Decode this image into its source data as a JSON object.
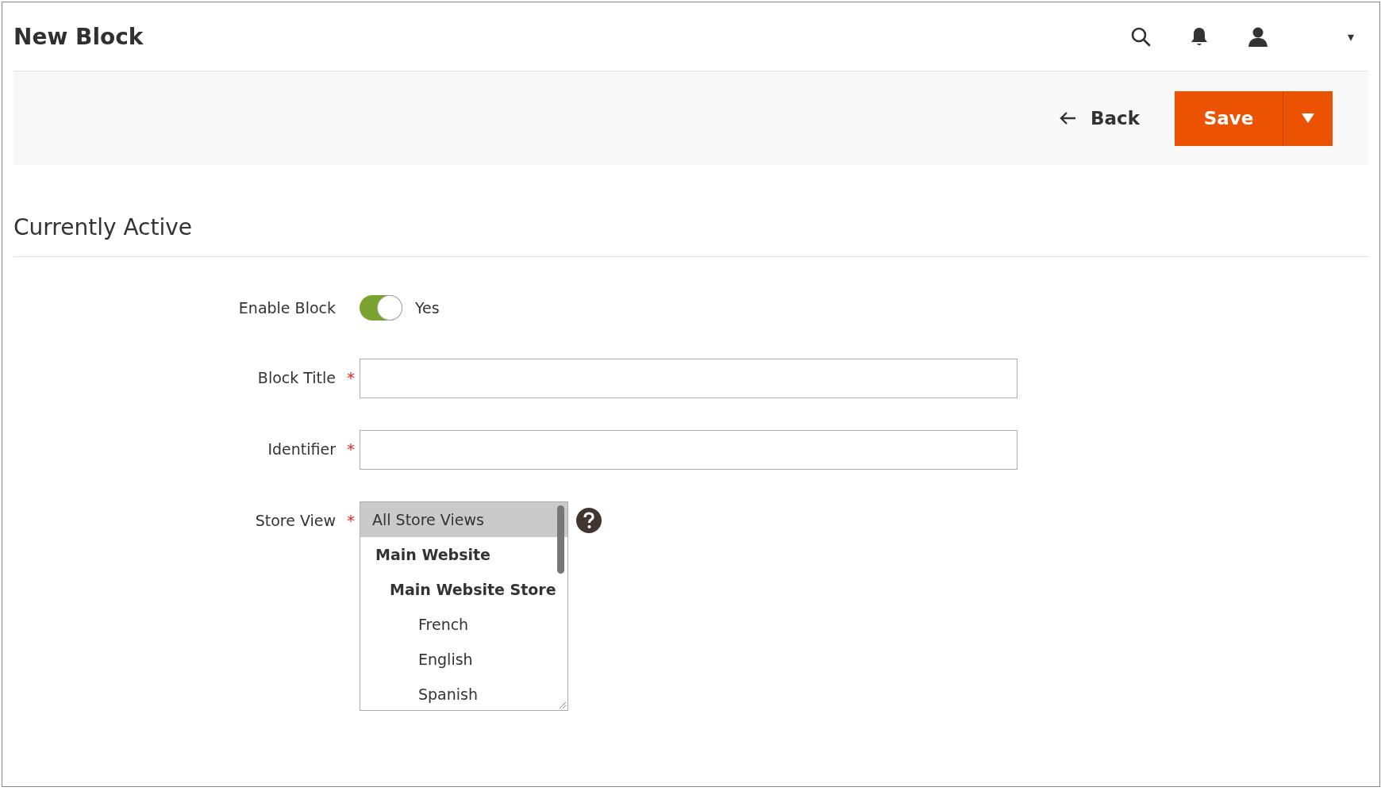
{
  "header": {
    "title": "New Block",
    "account_caret": "▾"
  },
  "actions": {
    "back": "Back",
    "save": "Save"
  },
  "section": {
    "title": "Currently Active"
  },
  "fields": [
    {
      "kind": "toggle",
      "label": "Enable Block",
      "on": true,
      "value_label": "Yes"
    },
    {
      "kind": "text",
      "label": "Block Title",
      "required_mark": "*"
    },
    {
      "kind": "text",
      "label": "Identifier",
      "required_mark": "*"
    },
    {
      "kind": "multiselect",
      "label": "Store View",
      "required_mark": "*",
      "options": [
        {
          "label": "All Store Views",
          "kind": "option",
          "selected": true
        },
        {
          "label": "Main Website",
          "kind": "group",
          "selected": false,
          "children": [
            {
              "label": "Main Website Store",
              "kind": "group",
              "selected": false,
              "children": [
                {
                  "label": "French",
                  "kind": "option",
                  "selected": false
                },
                {
                  "label": "English",
                  "kind": "option",
                  "selected": false
                },
                {
                  "label": "Spanish",
                  "kind": "option",
                  "selected": false
                }
              ]
            }
          ]
        }
      ]
    }
  ]
}
